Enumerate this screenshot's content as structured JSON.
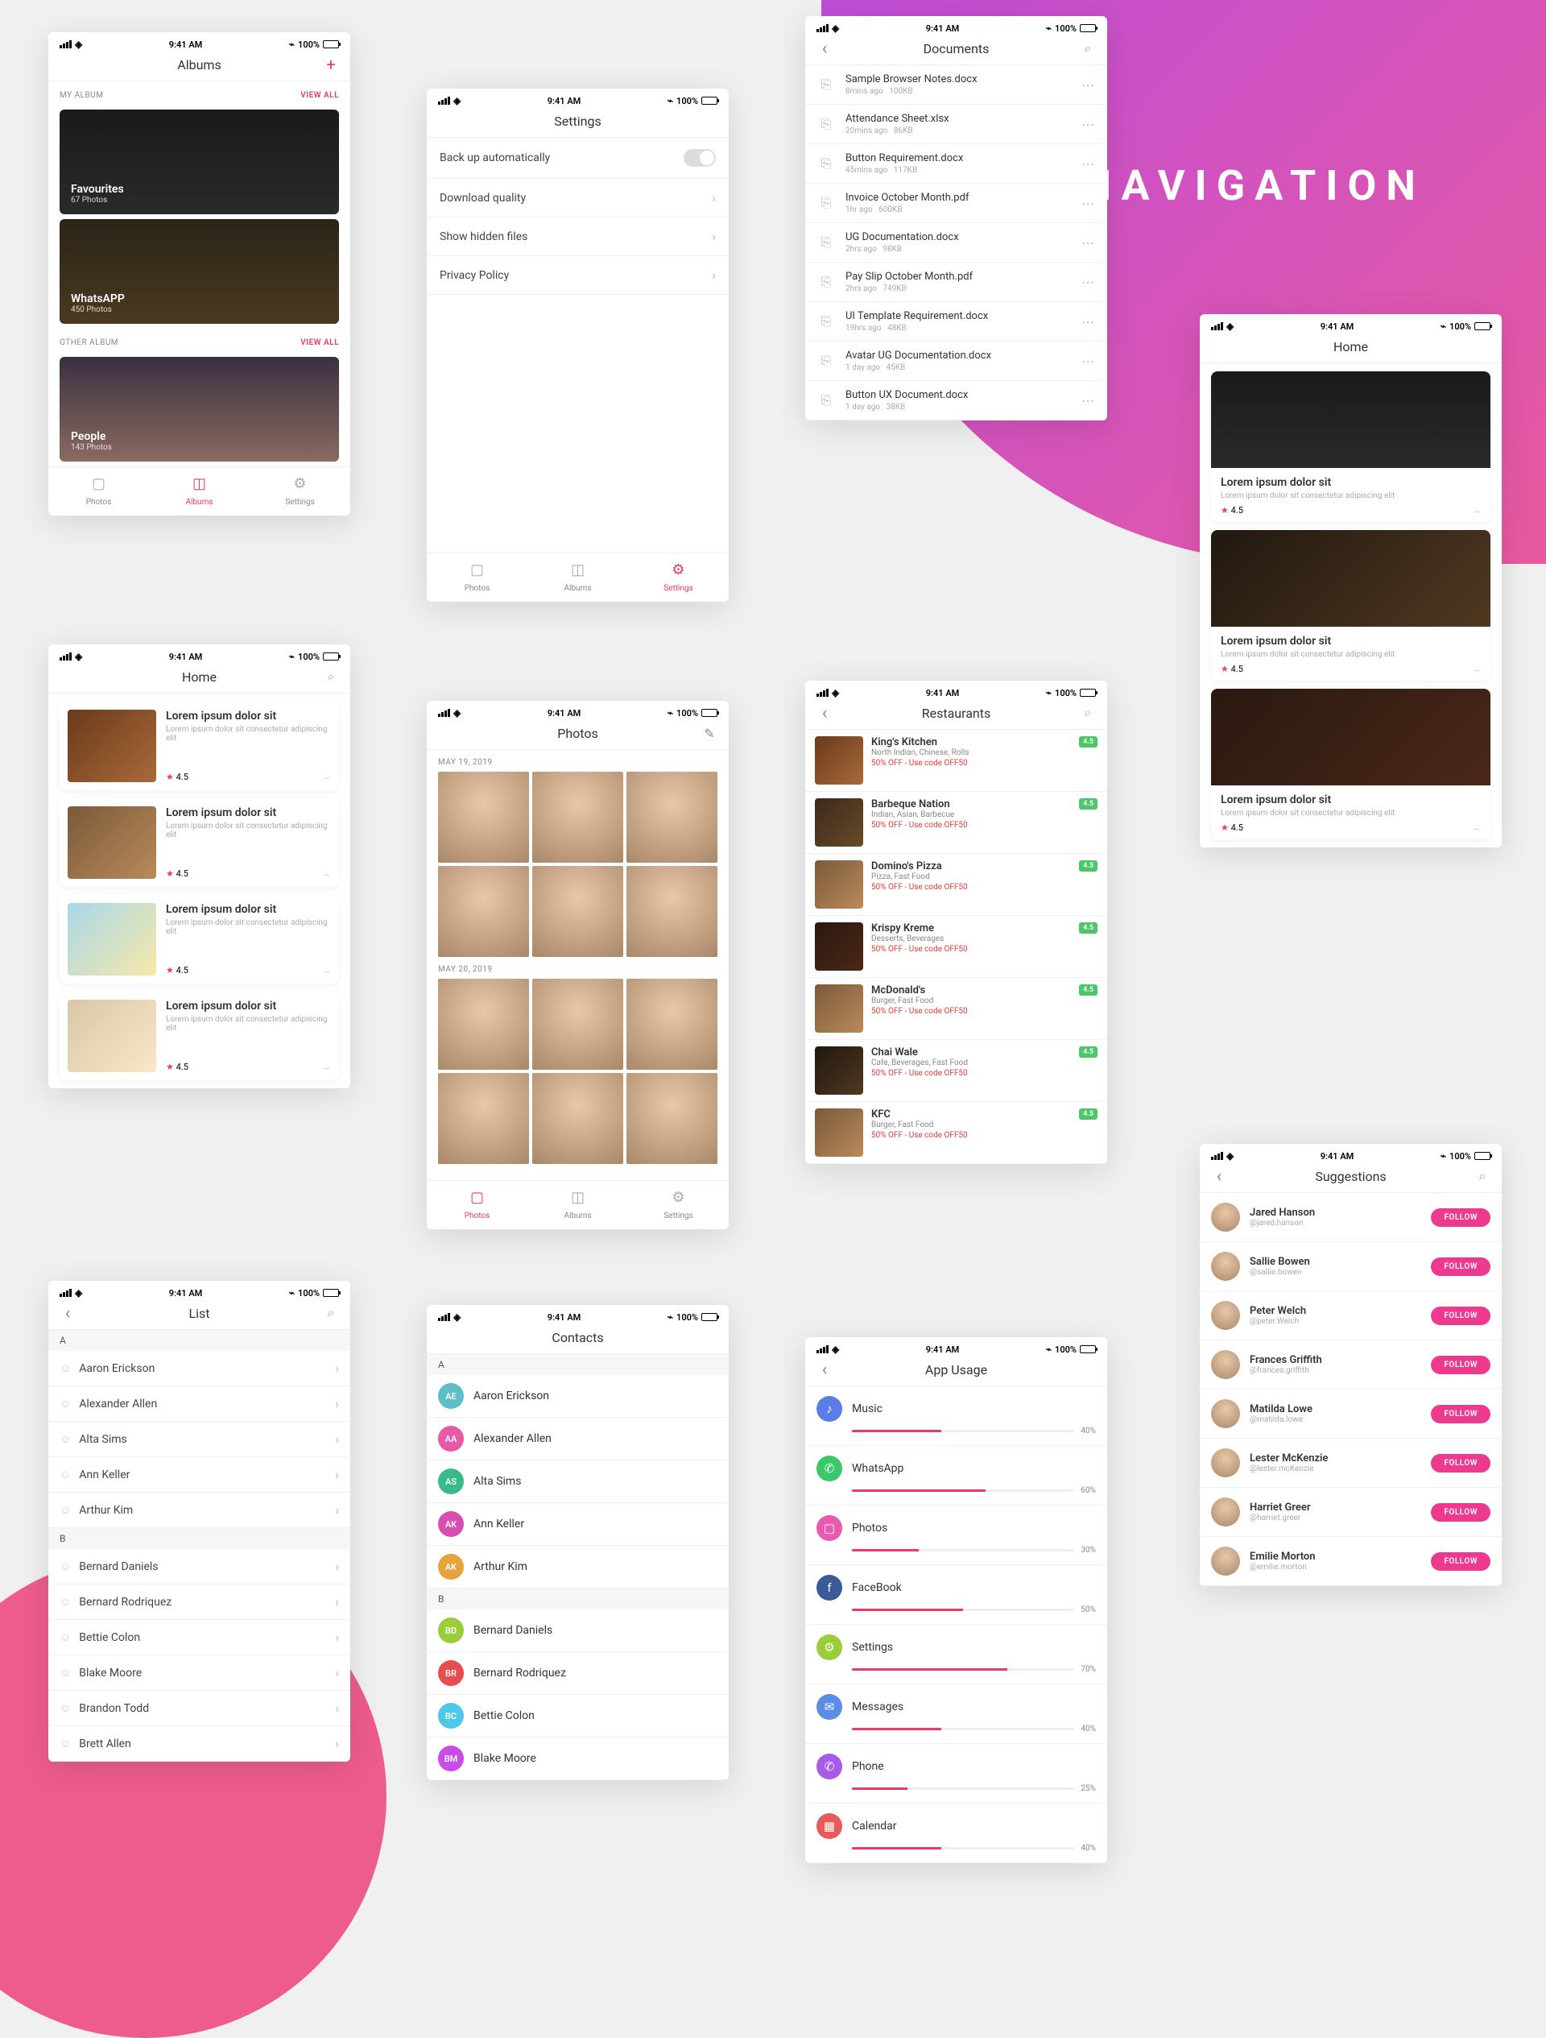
{
  "section_title": "NAVIGATION",
  "status": {
    "time": "9:41 AM",
    "battery": "100%"
  },
  "tabs": {
    "photos": "Photos",
    "albums": "Albums",
    "settings": "Settings"
  },
  "albums": {
    "title": "Albums",
    "my_label": "MY ALBUM",
    "viewall": "VIEW ALL",
    "other_label": "OTHER ALBUM",
    "cards": [
      {
        "title": "Favourites",
        "sub": "67 Photos"
      },
      {
        "title": "WhatsAPP",
        "sub": "450 Photos"
      },
      {
        "title": "People",
        "sub": "143 Photos"
      }
    ]
  },
  "settings": {
    "title": "Settings",
    "rows": [
      "Back up automatically",
      "Download  quality",
      "Show hidden files",
      "Privacy Policy"
    ]
  },
  "docs": {
    "title": "Documents",
    "items": [
      {
        "n": "Sample Browser Notes.docx",
        "t": "8mins ago",
        "s": "100KB"
      },
      {
        "n": "Attendance Sheet.xlsx",
        "t": "20mins ago",
        "s": "86KB"
      },
      {
        "n": "Button Requirement.docx",
        "t": "45mins ago",
        "s": "117KB"
      },
      {
        "n": "Invoice October Month.pdf",
        "t": "1hr ago",
        "s": "600KB"
      },
      {
        "n": "UG Documentation.docx",
        "t": "2hrs ago",
        "s": "98KB"
      },
      {
        "n": "Pay Slip October Month.pdf",
        "t": "2hrs ago",
        "s": "749KB"
      },
      {
        "n": "UI Template Requirement.docx",
        "t": "19hrs ago",
        "s": "48KB"
      },
      {
        "n": "Avatar UG Documentation.docx",
        "t": "1 day ago",
        "s": "45KB"
      },
      {
        "n": "Button UX Document.docx",
        "t": "1 day ago",
        "s": "38KB"
      }
    ]
  },
  "home": {
    "title": "Home",
    "card_title": "Lorem ipsum dolor sit",
    "card_desc": "Lorem ipsum dolor sit consectetur adipiscing elit",
    "rating": "4.5"
  },
  "photos": {
    "title": "Photos",
    "d1": "MAY 19, 2019",
    "d2": "MAY 20, 2019"
  },
  "rest": {
    "title": "Restaurants",
    "offer": "50% OFF - Use code OFF50",
    "badge": "4.5",
    "items": [
      {
        "n": "King's Kitchen",
        "c": "North Indian, Chinese, Rolls"
      },
      {
        "n": "Barbeque Nation",
        "c": "Indian, Asian, Barbecue"
      },
      {
        "n": "Domino's Pizza",
        "c": "Pizza, Fast Food"
      },
      {
        "n": "Krispy Kreme",
        "c": "Desserts, Beverages"
      },
      {
        "n": "McDonald's",
        "c": "Burger, Fast Food"
      },
      {
        "n": "Chai Wale",
        "c": "Cafe, Beverages, Fast Food"
      },
      {
        "n": "KFC",
        "c": "Burger, Fast Food"
      }
    ]
  },
  "list": {
    "title": "List",
    "a": [
      "Aaron Erickson",
      "Alexander Allen",
      "Alta Sims",
      "Ann Keller",
      "Arthur Kim"
    ],
    "b": [
      "Bernard Daniels",
      "Bernard Rodriquez",
      "Bettie Colon",
      "Blake Moore",
      "Brandon Todd",
      "Brett Allen"
    ]
  },
  "contacts": {
    "title": "Contacts",
    "a": [
      {
        "i": "AE",
        "n": "Aaron Erickson",
        "col": "#5dbdc9"
      },
      {
        "i": "AA",
        "n": "Alexander Allen",
        "col": "#e85aa5"
      },
      {
        "i": "AS",
        "n": "Alta Sims",
        "col": "#3aba88"
      },
      {
        "i": "AK",
        "n": "Ann Keller",
        "col": "#d84db0"
      },
      {
        "i": "AK",
        "n": "Arthur Kim",
        "col": "#e8a23a"
      }
    ],
    "b": [
      {
        "i": "BD",
        "n": "Bernard Daniels",
        "col": "#9acd3a"
      },
      {
        "i": "BR",
        "n": "Bernard Rodriquez",
        "col": "#e84d4d"
      },
      {
        "i": "BC",
        "n": "Bettie Colon",
        "col": "#4dc9e8"
      },
      {
        "i": "BM",
        "n": "Blake Moore",
        "col": "#c84de8"
      }
    ]
  },
  "usage": {
    "title": "App Usage",
    "items": [
      {
        "n": "Music",
        "p": 40,
        "col": "#5a7de8",
        "g": "♪"
      },
      {
        "n": "WhatsApp",
        "p": 60,
        "col": "#3ac96a",
        "g": "✆"
      },
      {
        "n": "Photos",
        "p": 30,
        "col": "#e85ab0",
        "g": "▢"
      },
      {
        "n": "FaceBook",
        "p": 50,
        "col": "#3a5a9a",
        "g": "f"
      },
      {
        "n": "Settings",
        "p": 70,
        "col": "#9acd3a",
        "g": "⚙"
      },
      {
        "n": "Messages",
        "p": 40,
        "col": "#5a8de8",
        "g": "✉"
      },
      {
        "n": "Phone",
        "p": 25,
        "col": "#a85ae8",
        "g": "✆"
      },
      {
        "n": "Calendar",
        "p": 40,
        "col": "#e85a5a",
        "g": "▦"
      }
    ]
  },
  "sugg": {
    "title": "Suggestions",
    "btn": "FOLLOW",
    "items": [
      {
        "n": "Jared Hanson",
        "h": "@jared.hanson"
      },
      {
        "n": "Sallie Bowen",
        "h": "@sallie.bowen"
      },
      {
        "n": "Peter Welch",
        "h": "@peter.Welch"
      },
      {
        "n": "Frances Griffith",
        "h": "@frances.griffith"
      },
      {
        "n": "Matilda Lowe",
        "h": "@matilda.lowe"
      },
      {
        "n": "Lester McKenzie",
        "h": "@lester.mcKenzie"
      },
      {
        "n": "Harriet Greer",
        "h": "@harriet.greer"
      },
      {
        "n": "Emilie Morton",
        "h": "@emilie.morton"
      }
    ]
  }
}
